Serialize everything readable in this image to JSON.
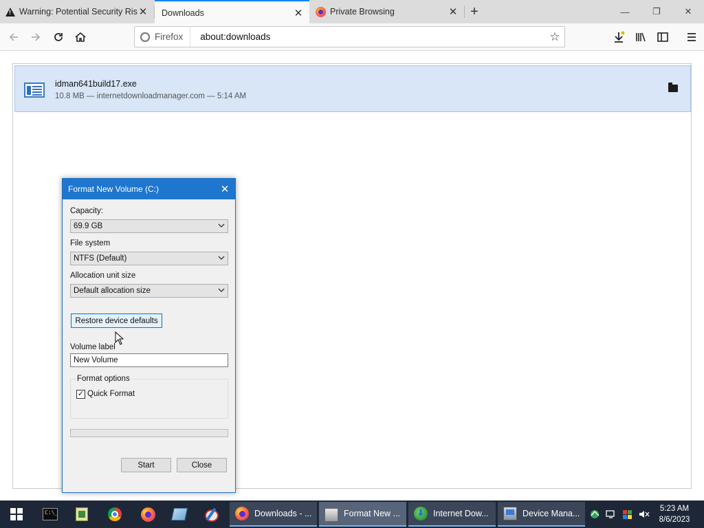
{
  "browser": {
    "tabs": [
      {
        "label": "Warning: Potential Security Risk",
        "icon": "warning-icon",
        "active": false
      },
      {
        "label": "Downloads",
        "icon": "none",
        "active": true
      },
      {
        "label": "Private Browsing",
        "icon": "firefox-icon",
        "active": false
      }
    ],
    "close_glyph": "✕",
    "new_tab_glyph": "+",
    "window_controls": {
      "minimize": "—",
      "restore": "❐",
      "close": "✕"
    },
    "urlbar": {
      "identity_label": "Firefox",
      "url": "about:downloads"
    }
  },
  "downloads": {
    "items": [
      {
        "filename": "idman641build17.exe",
        "meta": "10.8 MB — internetdownloadmanager.com — 5:14 AM"
      }
    ]
  },
  "format_dialog": {
    "title": "Format New Volume (C:)",
    "close_glyph": "✕",
    "capacity_label": "Capacity:",
    "capacity_value": "69.9 GB",
    "filesystem_label": "File system",
    "filesystem_value": "NTFS (Default)",
    "allocation_label": "Allocation unit size",
    "allocation_value": "Default allocation size",
    "restore_button": "Restore device defaults",
    "volume_label_label": "Volume label",
    "volume_label_value": "New Volume",
    "format_options_label": "Format options",
    "quick_format_label": "Quick Format",
    "quick_format_checked": true,
    "checkmark": "✓",
    "progress": 0,
    "start_button": "Start",
    "close_button": "Close",
    "chevron": "⌄"
  },
  "taskbar": {
    "tasks": [
      {
        "label": "Downloads - ...",
        "icon": "firefox-icon"
      },
      {
        "label": "Format New ...",
        "icon": "drive-icon"
      },
      {
        "label": "Internet Dow...",
        "icon": "idm-icon"
      },
      {
        "label": "Device Mana...",
        "icon": "device-manager-icon"
      }
    ],
    "clock": {
      "time": "5:23 AM",
      "date": "8/6/2023"
    }
  },
  "colors": {
    "accent": "#1f76cf",
    "download_highlight": "#d8e6f7",
    "taskbar": "#1d2737"
  }
}
